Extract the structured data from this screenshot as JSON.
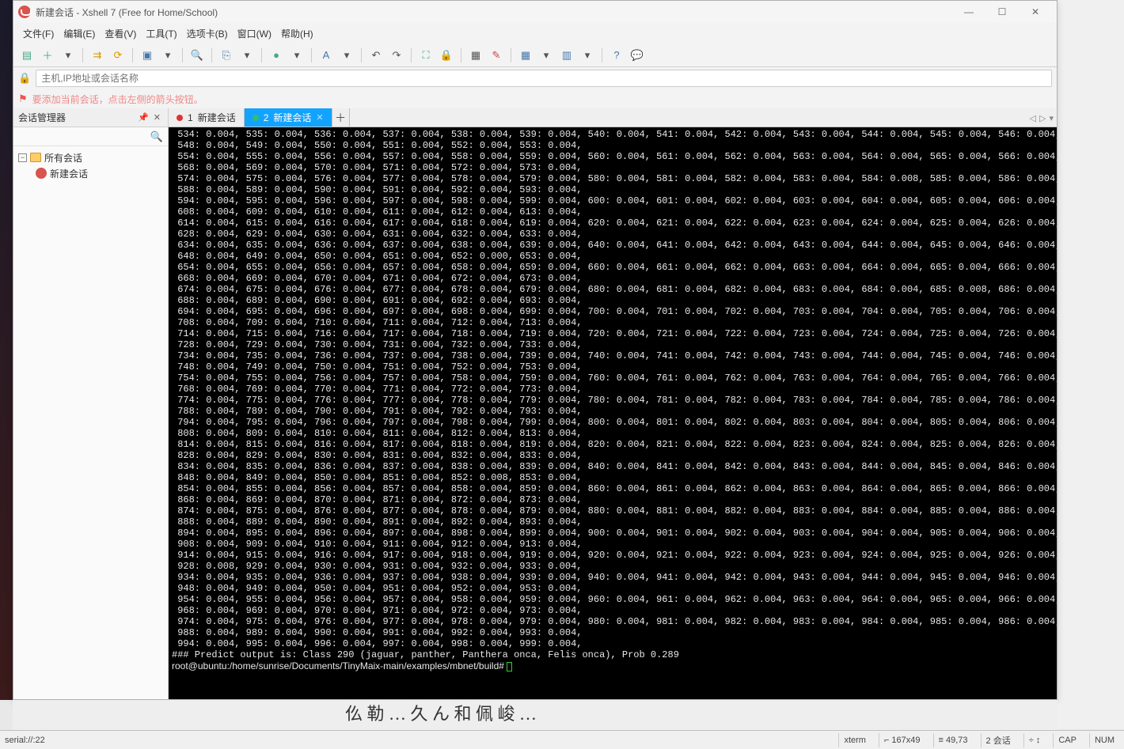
{
  "title": "新建会话 - Xshell 7 (Free for Home/School)",
  "menus": [
    "文件(F)",
    "编辑(E)",
    "查看(V)",
    "工具(T)",
    "选项卡(B)",
    "窗口(W)",
    "帮助(H)"
  ],
  "address_placeholder": "主机,IP地址或会话名称",
  "tip": "要添加当前会话，点击左侧的箭头按钮。",
  "sidebar": {
    "title": "会话管理器",
    "root": "所有会话",
    "child": "新建会话"
  },
  "tabs": [
    {
      "num": "1",
      "label": "新建会话",
      "active": false
    },
    {
      "num": "2",
      "label": "新建会话",
      "active": true
    }
  ],
  "term": {
    "overrides": {
      "584": "0.008",
      "652": "0.000",
      "685": "0.008",
      "852": "0.008",
      "928": "0.008"
    },
    "start": 534,
    "end": 999,
    "predict": "### Predict output is: Class 290 (jaguar, panther, Panthera onca, Felis onca), Prob 0.289",
    "prompt": "root@ubuntu:/home/sunrise/Documents/TinyMaix-main/examples/mbnet/build# "
  },
  "status": {
    "left": "serial://:22",
    "xterm": "xterm",
    "size": "⌐ 167x49",
    "pos": "≡ 49,73",
    "sess": "2 会话",
    "cap": "CAP",
    "num": "NUM",
    "extra": "  ÷  ↕"
  }
}
